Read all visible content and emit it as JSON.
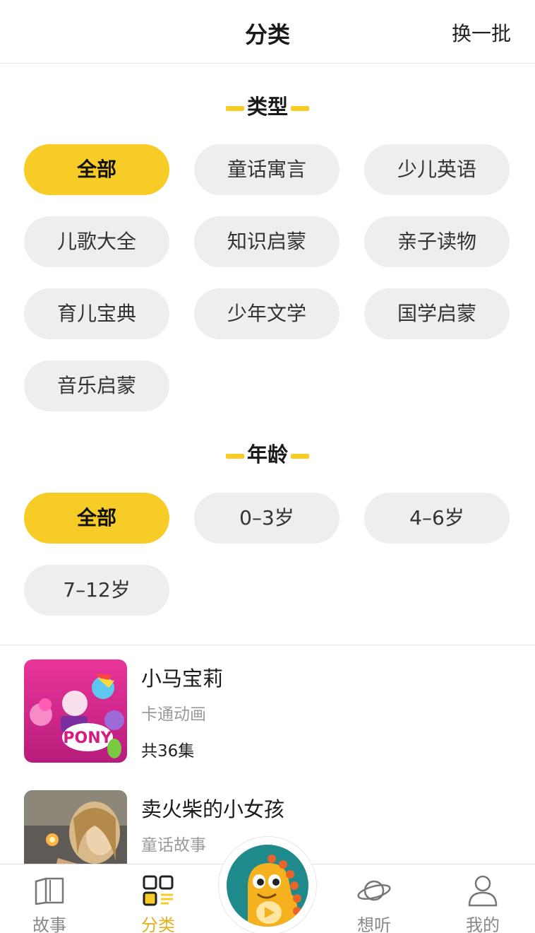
{
  "header": {
    "title": "分类",
    "refresh_label": "换一批"
  },
  "type_section": {
    "title": "类型",
    "chips": [
      {
        "label": "全部",
        "active": true
      },
      {
        "label": "童话寓言",
        "active": false
      },
      {
        "label": "少儿英语",
        "active": false
      },
      {
        "label": "儿歌大全",
        "active": false
      },
      {
        "label": "知识启蒙",
        "active": false
      },
      {
        "label": "亲子读物",
        "active": false
      },
      {
        "label": "育儿宝典",
        "active": false
      },
      {
        "label": "少年文学",
        "active": false
      },
      {
        "label": "国学启蒙",
        "active": false
      },
      {
        "label": "音乐启蒙",
        "active": false
      }
    ]
  },
  "age_section": {
    "title": "年龄",
    "chips": [
      {
        "label": "全部",
        "active": true
      },
      {
        "label": "0–3岁",
        "active": false
      },
      {
        "label": "4–6岁",
        "active": false
      },
      {
        "label": "7–12岁",
        "active": false
      }
    ]
  },
  "results": [
    {
      "title": "小马宝莉",
      "category": "卡通动画",
      "episodes": "共36集",
      "cover_icon": "my-little-pony-cover"
    },
    {
      "title": "卖火柴的小女孩",
      "category": "童话故事",
      "episodes": "",
      "cover_icon": "match-girl-cover"
    }
  ],
  "tabbar": {
    "tabs": [
      {
        "label": "故事",
        "icon": "book-icon",
        "active": false
      },
      {
        "label": "分类",
        "icon": "grid-icon",
        "active": true
      },
      {
        "label": "想听",
        "icon": "planet-icon",
        "active": false
      },
      {
        "label": "我的",
        "icon": "person-icon",
        "active": false
      }
    ],
    "center_icon": "dinosaur-play-icon"
  },
  "colors": {
    "accent": "#f8cc26",
    "chip_bg": "#eeeeee",
    "active_tab": "#e3b019",
    "center_bg": "#1f8a8c"
  }
}
